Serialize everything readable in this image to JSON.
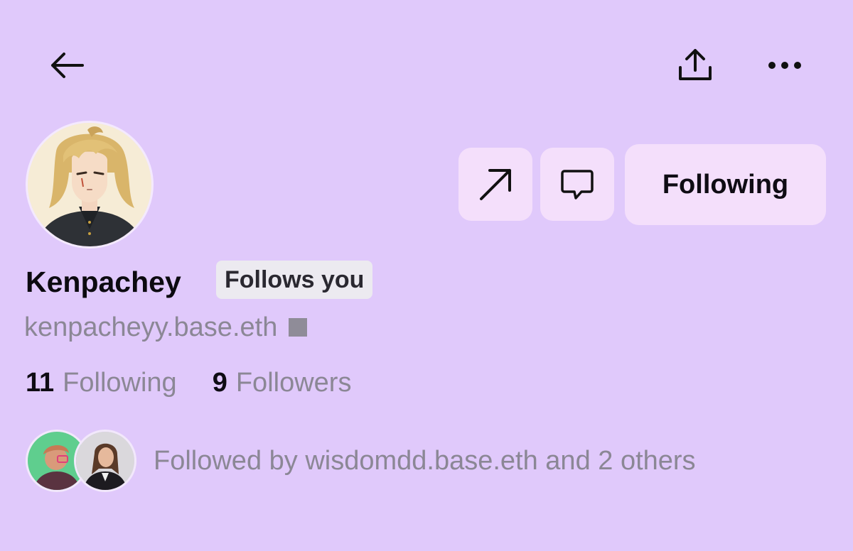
{
  "header": {
    "back_icon": "arrow-left-icon",
    "share_icon": "share-upload-icon",
    "more_icon": "more-horizontal-icon"
  },
  "profile": {
    "avatar_icon": "anime-character-avatar",
    "name": "Kenpachey",
    "follows_you_badge": "Follows you",
    "handle": "kenpacheyy.base.eth",
    "following_count": "11",
    "following_label": "Following",
    "followers_count": "9",
    "followers_label": "Followers"
  },
  "actions": {
    "link_icon": "arrow-up-right-icon",
    "message_icon": "chat-bubble-icon",
    "following_button": "Following"
  },
  "mutuals": {
    "text": "Followed by wisdomdd.base.eth and 2 others",
    "avatars": [
      "mutual-avatar-1",
      "mutual-avatar-2"
    ]
  },
  "colors": {
    "background": "#e0c9fb",
    "button_bg": "#f4dffb",
    "muted_text": "#8b8795"
  }
}
